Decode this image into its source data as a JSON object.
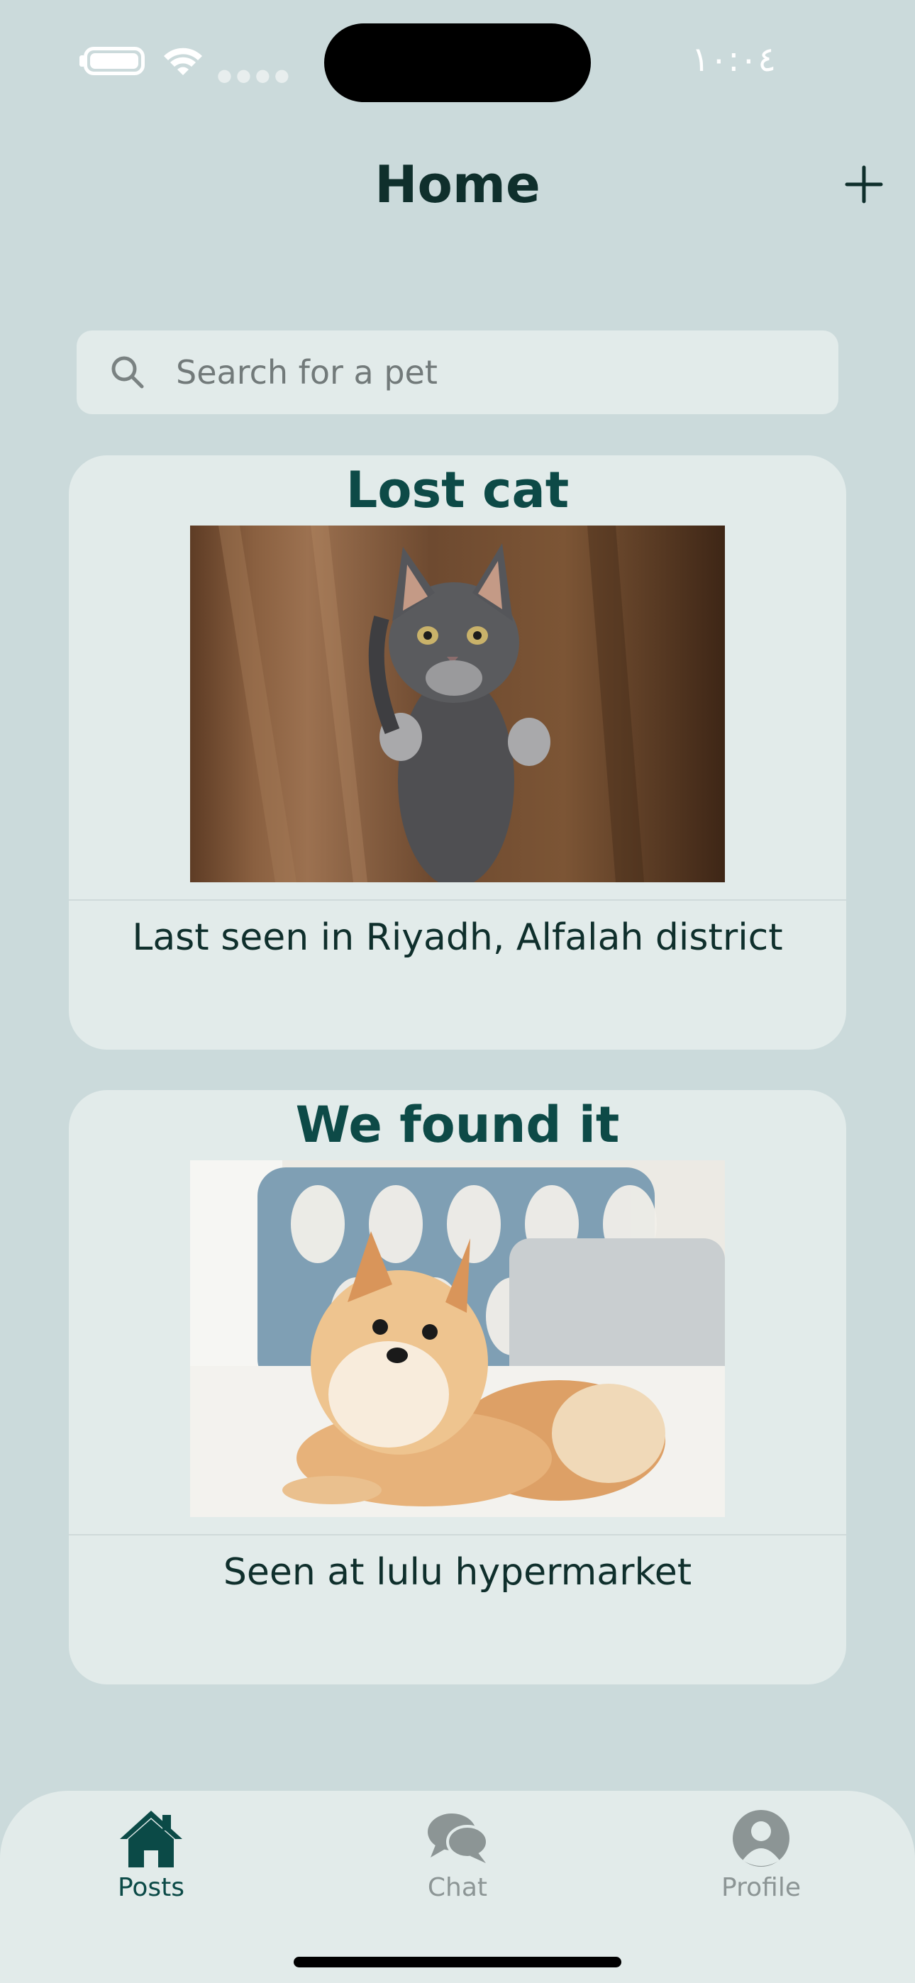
{
  "status_bar": {
    "time": "١٠:٠٤",
    "icons": [
      "battery-icon",
      "wifi-icon",
      "signal-icon"
    ]
  },
  "header": {
    "title": "Home",
    "add_icon": "plus-icon"
  },
  "search": {
    "placeholder": "Search for a pet",
    "icon": "search-icon"
  },
  "posts": [
    {
      "title": "Lost cat",
      "image": "gray-cat-photo",
      "caption": "Last seen in Riyadh, Alfalah district"
    },
    {
      "title": "We found it",
      "image": "pomeranian-dog-photo",
      "caption": "Seen at lulu hypermarket"
    }
  ],
  "tab_bar": {
    "tabs": [
      {
        "label": "Posts",
        "icon": "house-icon",
        "active": true
      },
      {
        "label": "Chat",
        "icon": "chat-bubbles-icon",
        "active": false
      },
      {
        "label": "Profile",
        "icon": "person-icon",
        "active": false
      }
    ]
  },
  "colors": {
    "background": "#cbdadb",
    "card": "#e2ebea",
    "accent": "#0d4a47",
    "inactive": "#8c9595"
  }
}
